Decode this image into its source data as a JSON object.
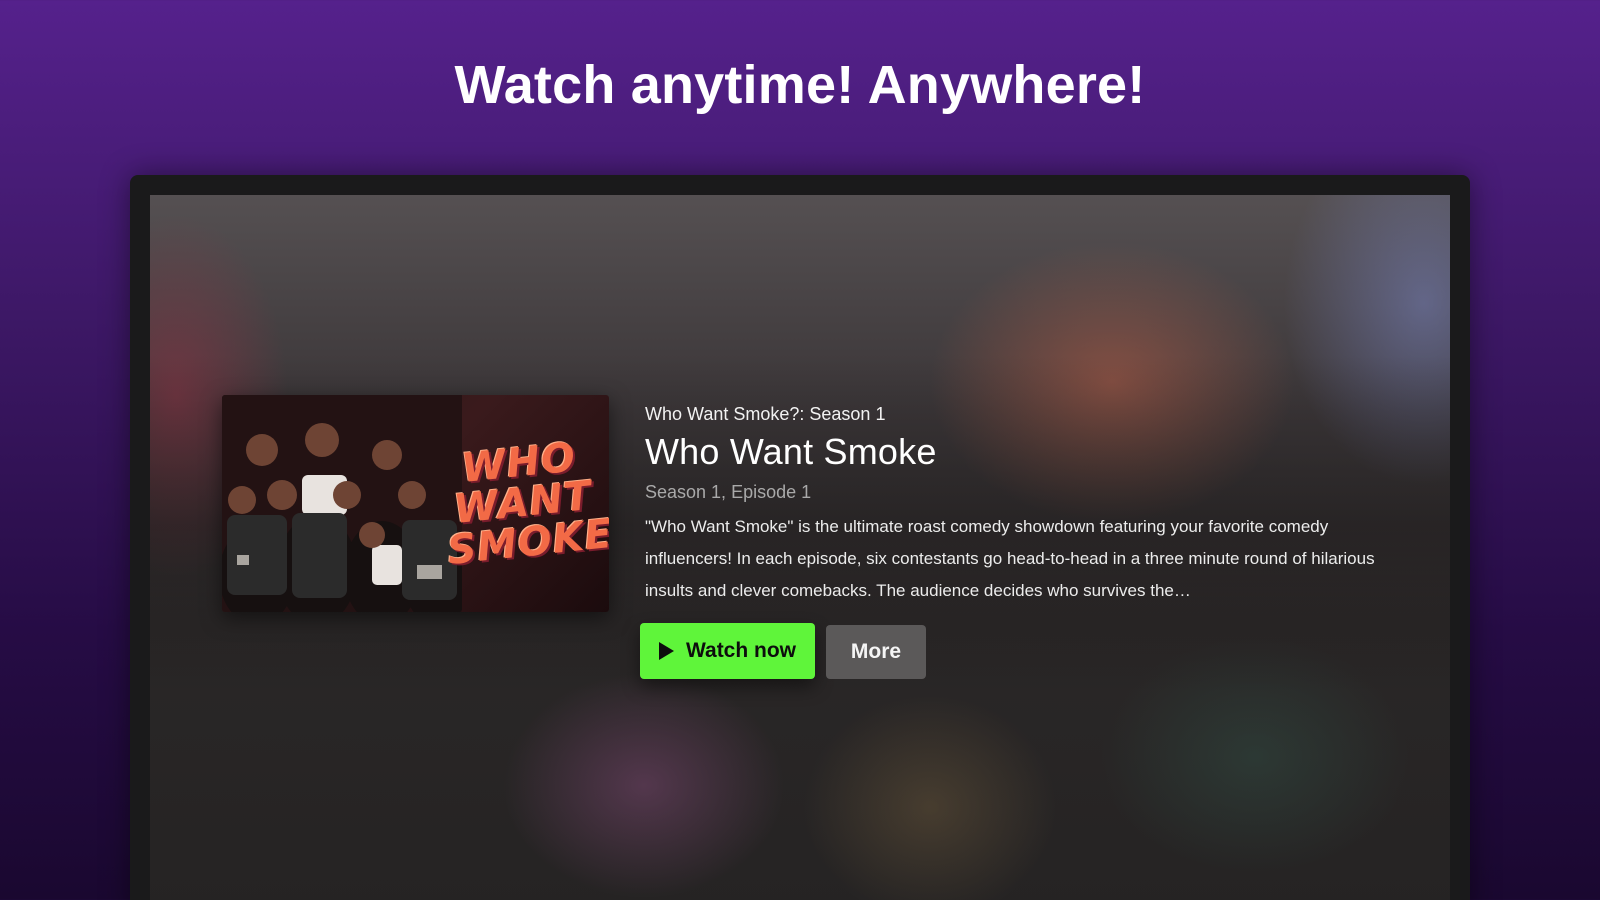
{
  "promo": {
    "headline": "Watch anytime! Anywhere!"
  },
  "feature": {
    "series_line": "Who Want Smoke?: Season 1",
    "title": "Who Want Smoke",
    "episode": "Season 1, Episode 1",
    "description": "\"Who Want Smoke\" is the ultimate roast comedy showdown featuring your favorite comedy influencers! In each episode, six contestants go head-to-head in a three minute round of hilarious insults and clever comebacks. The audience decides who survives the…",
    "thumbnail": {
      "art_text": "WHO WANT SMOKE?",
      "art_color": "#f26a46"
    }
  },
  "actions": {
    "watch_label": "Watch now",
    "watch_icon": "play-icon",
    "watch_color": "#5ff53a",
    "more_label": "More"
  },
  "colors": {
    "background_top": "#55218c",
    "background_bottom": "#1a0830",
    "more_button": "#5b5959"
  }
}
